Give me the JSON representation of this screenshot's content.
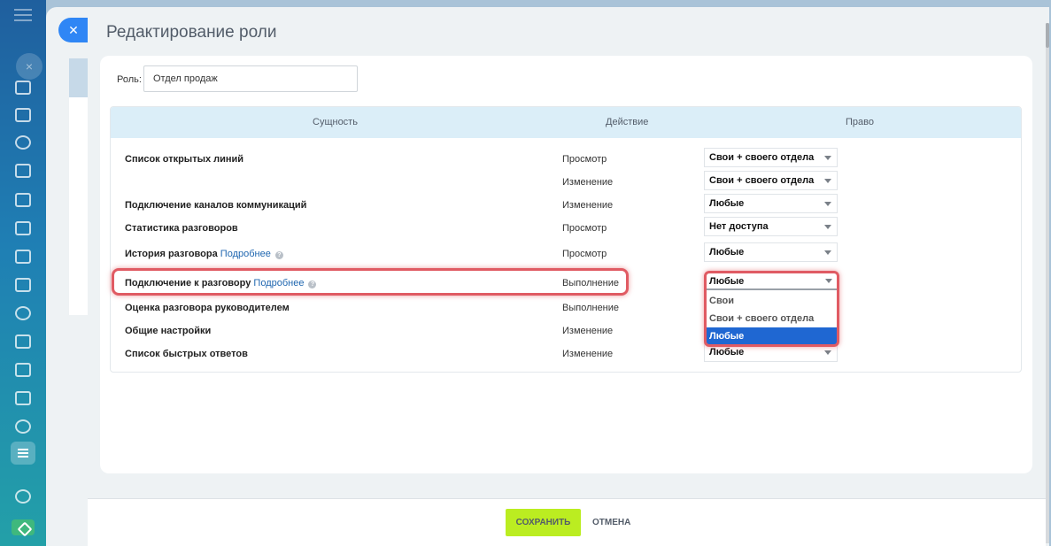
{
  "slider": {
    "title": "Редактирование роли"
  },
  "role": {
    "label": "Роль:",
    "value": "Отдел продаж"
  },
  "table": {
    "headers": [
      "Сущность",
      "Действие",
      "Право"
    ],
    "rows": [
      {
        "entity": "Список открытых линий",
        "action": "Просмотр",
        "right": "Свои + своего отдела"
      },
      {
        "entity": "",
        "action": "Изменение",
        "right": "Свои + своего отдела"
      },
      {
        "entity": "Подключение каналов коммуникаций",
        "action": "Изменение",
        "right": "Любые"
      },
      {
        "entity": "Статистика разговоров",
        "action": "Просмотр",
        "right": "Нет доступа"
      },
      {
        "entity": "История разговора",
        "link": "Подробнее",
        "action": "Просмотр",
        "right": "Любые"
      },
      {
        "entity": "Подключение к разговору",
        "link": "Подробнее",
        "action": "Выполнение",
        "right": "Любые"
      },
      {
        "entity": "Оценка разговора руководителем",
        "action": "Выполнение",
        "right": ""
      },
      {
        "entity": "Общие настройки",
        "action": "Изменение",
        "right": ""
      },
      {
        "entity": "Список быстрых ответов",
        "action": "Изменение",
        "right": "Любые"
      }
    ]
  },
  "dropdown": {
    "current": "Любые",
    "options": [
      "Свои",
      "Свои + своего отдела",
      "Любые"
    ],
    "selected_index": 2
  },
  "footer": {
    "save_label": "СОХРАНИТЬ",
    "cancel_label": "ОТМЕНА"
  },
  "colors": {
    "accent": "#2f86f5",
    "save": "#bbed21",
    "highlight": "#e05b63",
    "selected_option": "#1f67d2",
    "header_bg": "#dbeef8"
  },
  "icons": {
    "close": "close-icon",
    "help": "help-icon",
    "caret": "chevron-down-icon"
  }
}
